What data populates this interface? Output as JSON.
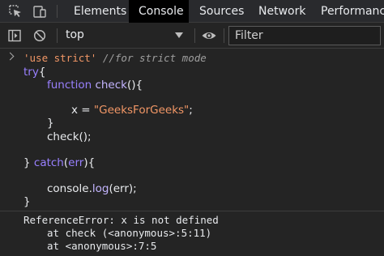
{
  "tabbar": {
    "tabs": [
      {
        "label": "Elements",
        "active": false
      },
      {
        "label": "Console",
        "active": true
      },
      {
        "label": "Sources",
        "active": false
      },
      {
        "label": "Network",
        "active": false
      },
      {
        "label": "Performance",
        "active": false
      }
    ],
    "icons": [
      "inspect-element-icon",
      "device-toolbar-icon"
    ]
  },
  "toolbar": {
    "context_value": "top",
    "filter_placeholder": "Filter",
    "icons": [
      "sidebar-toggle-icon",
      "clear-console-icon",
      "eye-icon"
    ]
  },
  "console": {
    "input_line": {
      "string": "'use strict'",
      "comment": "//for strict mode"
    },
    "code": {
      "try_kw": "try",
      "try_brace": "{",
      "function_kw": "function",
      "function_name": "check",
      "function_sig_rest": "(){",
      "assign_var": "x",
      "assign_op": " = ",
      "assign_value": "\"GeeksForGeeks\"",
      "assign_semicolon": ";",
      "close_brace": "}",
      "call": "check();",
      "catch_close": "} ",
      "catch_kw": "catch",
      "catch_open": "(",
      "catch_param": "err",
      "catch_rest": "){",
      "log_object": "console.",
      "log_method": "log",
      "log_args": "(err);",
      "final_brace": "}"
    },
    "error": {
      "message": "ReferenceError: x is not defined",
      "stack": [
        "at check (<anonymous>:5:11)",
        "at <anonymous>:7:5"
      ]
    }
  },
  "colors": {
    "background": "#242424",
    "string": "#f29766",
    "keyword": "#9980ff",
    "function": "#c4b5ff",
    "comment": "#9e9e9e",
    "text": "#e8eaed"
  }
}
